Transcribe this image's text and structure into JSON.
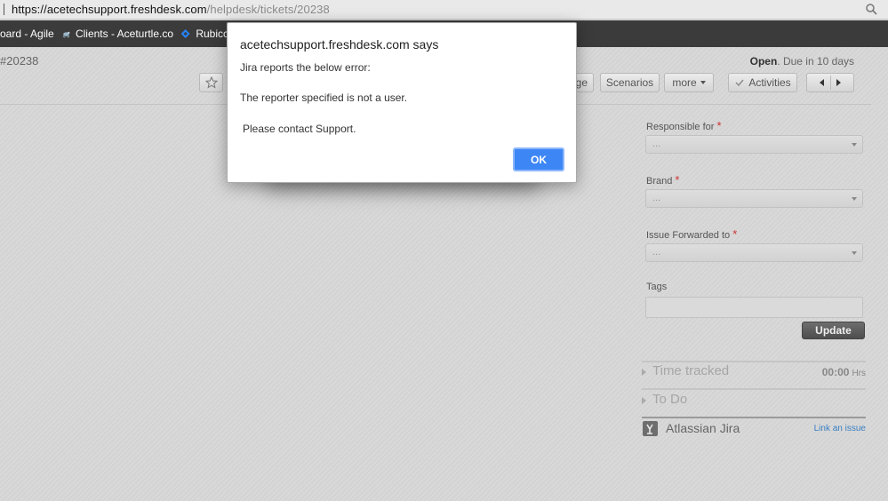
{
  "browser": {
    "url_host": "https://acetechsupport.freshdesk.com",
    "url_path": "/helpdesk/tickets/20238",
    "bookmarks": [
      {
        "label": "oard - Agile",
        "icon": "board-icon"
      },
      {
        "label": "Clients - Aceturtle.co",
        "icon": "turtle-icon"
      },
      {
        "label": "Rubicc",
        "icon": "jira-diamond-icon"
      }
    ]
  },
  "ticket": {
    "id_label": "#20238",
    "status_label": "Open",
    "due_label": ". Due in 10 days"
  },
  "toolbar": {
    "partial_label": "ge",
    "scenarios_label": "Scenarios",
    "more_label": "more",
    "activities_label": "Activities"
  },
  "properties": {
    "responsible_label": "Responsible for",
    "brand_label": "Brand",
    "forwarded_label": "Issue Forwarded to",
    "select_placeholder": "...",
    "tags_label": "Tags",
    "update_label": "Update"
  },
  "sidebar_sections": {
    "time_tracked_label": "Time tracked",
    "time_value": "00:00",
    "time_unit": "Hrs",
    "todo_label": "To Do",
    "jira_label": "Atlassian Jira",
    "link_issue_label": "Link an issue"
  },
  "alert": {
    "title": "acetechsupport.freshdesk.com says",
    "line1": "Jira reports the below error:",
    "line2": "The reporter specified is not a user.",
    "line3": "Please contact Support.",
    "ok_label": "OK"
  },
  "colors": {
    "accent_blue": "#3d86f5",
    "required_red": "#cc3333",
    "bookmark_bar": "#3b3b3b"
  }
}
